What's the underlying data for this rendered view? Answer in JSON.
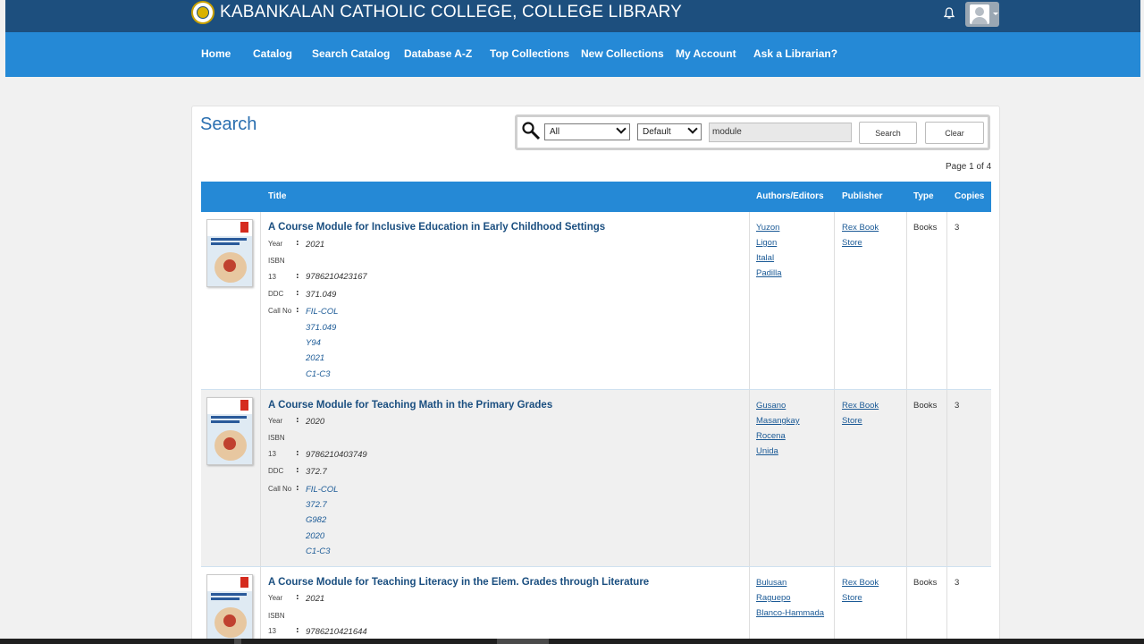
{
  "header": {
    "app_title": "KABANKALAN CATHOLIC COLLEGE, COLLEGE LIBRARY",
    "logo_icon": "college-seal-icon",
    "bell_icon": "bell-icon",
    "avatar_icon": "user-avatar-icon"
  },
  "nav": {
    "items": [
      "Home",
      "Catalog",
      "Search Catalog",
      "Database A-Z",
      "Top Collections",
      "New Collections",
      "My Account",
      "Ask a Librarian?"
    ]
  },
  "search": {
    "title": "Search",
    "scope_value": "All",
    "sort_value": "Default",
    "query": "module",
    "search_label": "Search",
    "clear_label": "Clear"
  },
  "pagination": {
    "text": "Page 1 of 4"
  },
  "table": {
    "headers": {
      "title": "Title",
      "authors": "Authors/Editors",
      "publisher": "Publisher",
      "type": "Type",
      "copies": "Copies"
    },
    "labels": {
      "year": "Year",
      "isbn_1": "ISBN",
      "isbn_2": "13",
      "ddc": "DDC",
      "callno": "Call No",
      "colon": ":"
    },
    "rows": [
      {
        "title": "A Course Module for Inclusive Education in Early Childhood Settings",
        "year": "2021",
        "isbn": "9786210423167",
        "ddc": "371.049",
        "call_no": [
          "FIL-COL",
          "371.049",
          "Y94",
          "2021",
          "C1-C3"
        ],
        "authors": [
          "Yuzon",
          "Ligon",
          "Italal",
          "Padilla"
        ],
        "publisher": [
          "Rex Book",
          "Store"
        ],
        "type": "Books",
        "copies": "3"
      },
      {
        "title": "A Course Module for Teaching Math in the Primary Grades",
        "year": "2020",
        "isbn": "9786210403749",
        "ddc": "372.7",
        "call_no": [
          "FIL-COL",
          "372.7",
          "G982",
          "2020",
          "C1-C3"
        ],
        "authors": [
          "Gusano",
          "Masangkay",
          "Rocena",
          "Unida"
        ],
        "publisher": [
          "Rex Book",
          "Store"
        ],
        "type": "Books",
        "copies": "3"
      },
      {
        "title": "A Course Module for Teaching Literacy in the Elem. Grades through Literature",
        "year": "2021",
        "isbn": "9786210421644",
        "authors": [
          "Bulusan",
          "Raguepo",
          "Blanco-Hammada"
        ],
        "publisher": [
          "Rex Book",
          "Store"
        ],
        "type": "Books",
        "copies": "3"
      }
    ]
  },
  "colors": {
    "topbar": "#1d4f7e",
    "navbar": "#2589d6",
    "link": "#1b5a96",
    "title_link": "#1b4f80"
  }
}
